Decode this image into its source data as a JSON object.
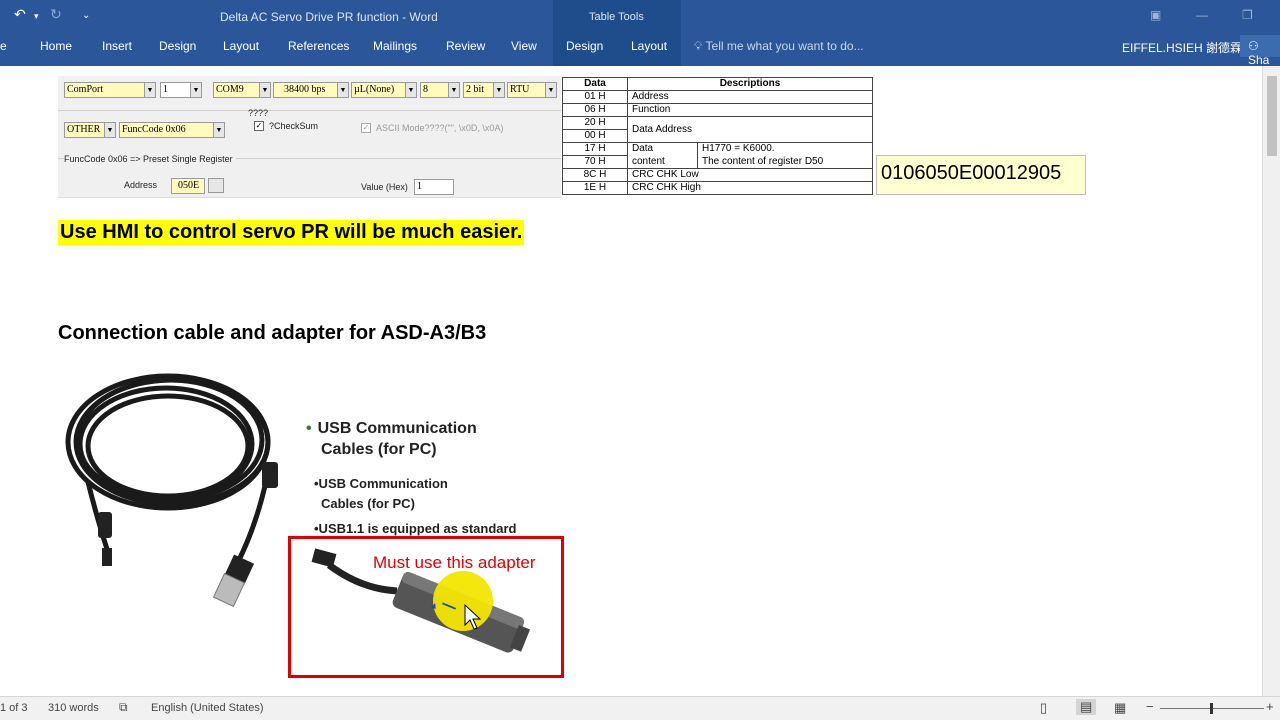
{
  "window": {
    "title": "Delta AC Servo Drive PR function - Word",
    "table_tools": "Table Tools",
    "tabs": [
      "Home",
      "Insert",
      "Design",
      "Layout",
      "References",
      "Mailings",
      "Review",
      "View",
      "Design",
      "Layout"
    ],
    "tell_me": "Tell me what you want to do...",
    "user": "EIFFEL.HSIEH 謝德霖",
    "share": "Sha",
    "file_stub": "e"
  },
  "tool": {
    "port_label": "ComPort",
    "port_num": "1",
    "com": "COM9",
    "baud": "38400",
    "bps": "bps",
    "parity": "µL(None)",
    "databits": "8",
    "stopbits": "2 bit",
    "mode": "RTU",
    "other": "OTHER",
    "funccode": "FuncCode 0x06",
    "unknown_label": "????",
    "checksum": "?CheckSum",
    "ascii_mode": "ASCII Mode????(\"\", \\x0D, \\x0A)",
    "func_desc": "FuncCode 0x06 => Preset Single Register",
    "address_label": "Address",
    "address_value": "050E",
    "value_label": "Value (Hex)",
    "value_value": "1"
  },
  "table": {
    "headers": [
      "Data",
      "Descriptions"
    ],
    "rows": [
      {
        "data": "01 H",
        "desc": "Address"
      },
      {
        "data": "06 H",
        "desc": "Function"
      },
      {
        "data": "20 H",
        "desc": "Data Address"
      },
      {
        "data": "00 H",
        "desc": ""
      },
      {
        "data": "17 H",
        "desc": "Data",
        "detail": "H1770 = K6000."
      },
      {
        "data": "70 H",
        "desc": "content",
        "detail": "The content of register D50"
      },
      {
        "data": "8C H",
        "desc": "CRC CHK Low"
      },
      {
        "data": "1E H",
        "desc": "CRC CHK High"
      }
    ]
  },
  "result_value": "0106050E00012905",
  "hmi_note": "Use HMI to control servo PR will be much easier.",
  "section_heading": "Connection cable and adapter for ASD-A3/B3",
  "product": {
    "bullet_main_line1": "USB Communication",
    "bullet_main_line2": "Cables (for PC)",
    "sub1_line1": "•USB Communication",
    "sub1_line2": "Cables (for PC)",
    "sub2": "•USB1.1 is equipped as standard",
    "adapter_label": "Must use this adapter"
  },
  "status": {
    "page": "1 of 3",
    "words": "310 words",
    "language": "English (United States)"
  }
}
